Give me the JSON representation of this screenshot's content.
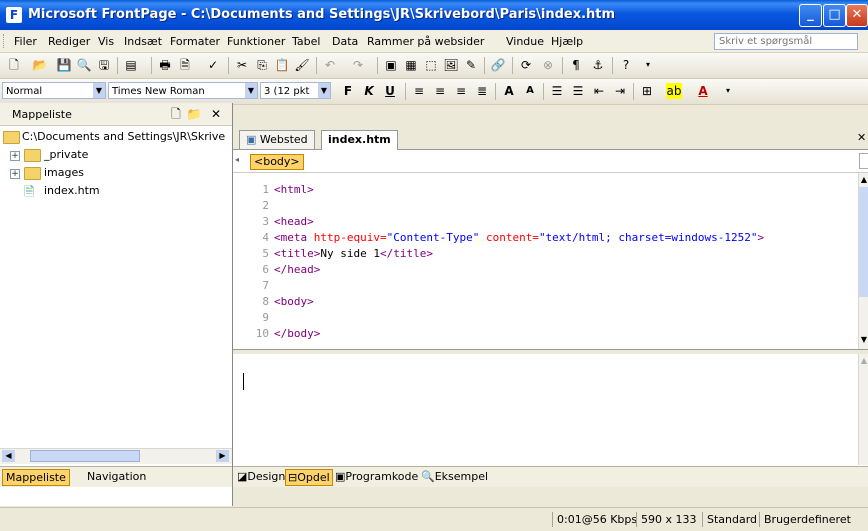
{
  "window": {
    "title": "Microsoft FrontPage - C:\\Documents and Settings\\JR\\Skrivebord\\Paris\\index.htm"
  },
  "menu": {
    "items": [
      "Filer",
      "Rediger",
      "Vis",
      "Indsæt",
      "Formater",
      "Funktioner",
      "Tabel",
      "Data",
      "Rammer på websider",
      "Vindue",
      "Hjælp"
    ],
    "ask_placeholder": "Skriv et spørgsmål"
  },
  "format_toolbar": {
    "style": "Normal",
    "font": "Times New Roman",
    "size": "3 (12 pkt"
  },
  "folder_pane": {
    "title": "Mappeliste",
    "root": "C:\\Documents and Settings\\JR\\Skrive",
    "items": [
      "_private",
      "images",
      "index.htm"
    ]
  },
  "pane_tabs": {
    "folders": "Mappeliste",
    "navigation": "Navigation"
  },
  "doc_tabs": {
    "site": "Websted",
    "file": "index.htm"
  },
  "tag_selector": "<body>",
  "code_lines": [
    {
      "n": "1",
      "text": "<html>"
    },
    {
      "n": "2",
      "text": ""
    },
    {
      "n": "3",
      "text": "<head>"
    },
    {
      "n": "4",
      "text": "<meta http-equiv=\"Content-Type\" content=\"text/html; charset=windows-1252\">"
    },
    {
      "n": "5",
      "text": "<title>Ny side 1</title>"
    },
    {
      "n": "6",
      "text": "</head>"
    },
    {
      "n": "7",
      "text": ""
    },
    {
      "n": "8",
      "text": "<body>"
    },
    {
      "n": "9",
      "text": ""
    },
    {
      "n": "10",
      "text": "</body>"
    }
  ],
  "view_tabs": {
    "design": "Design",
    "split": "Opdel",
    "code": "Programkode",
    "preview": "Eksempel"
  },
  "status": {
    "speed": "0:01@56 Kbps",
    "size": "590 x 133",
    "mode": "Standard",
    "custom": "Brugerdefineret"
  },
  "colors": {
    "titlebar": "#0447cf",
    "highlight": "#ffd36b",
    "tag": "#800080",
    "attr": "#ff0000",
    "value": "#0000ff"
  }
}
